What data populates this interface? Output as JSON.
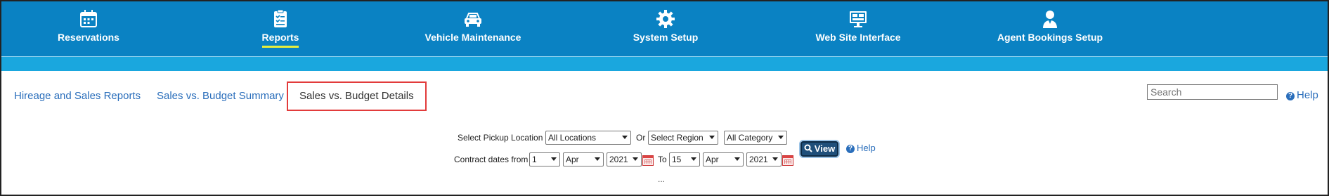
{
  "nav": {
    "items": [
      {
        "label": "Reservations",
        "icon": "calendar-icon"
      },
      {
        "label": "Reports",
        "icon": "clipboard-checklist-icon",
        "active": true
      },
      {
        "label": "Vehicle Maintenance",
        "icon": "car-icon"
      },
      {
        "label": "System Setup",
        "icon": "gear-icon"
      },
      {
        "label": "Web Site Interface",
        "icon": "monitor-icon"
      },
      {
        "label": "Agent Bookings Setup",
        "icon": "agent-user-icon"
      }
    ]
  },
  "tabs": [
    {
      "label": "Hireage and Sales Reports"
    },
    {
      "label": "Sales vs. Budget Summary"
    },
    {
      "label": "Sales vs. Budget Details",
      "selected": true
    }
  ],
  "search": {
    "placeholder": "Search"
  },
  "help_label": "Help",
  "form": {
    "pickup_label": "Select Pickup Location",
    "pickup_value": "All Locations",
    "or_label": "Or",
    "region_value": "Select Region",
    "category_value": "All Category",
    "contract_label": "Contract dates from",
    "from_day": "1",
    "from_month": "Apr",
    "from_year": "2021",
    "to_label": "To",
    "to_day": "15",
    "to_month": "Apr",
    "to_year": "2021",
    "view_label": "View",
    "help_label": "Help",
    "ellipsis": "..."
  },
  "colors": {
    "nav_bg": "#0a82c3",
    "accent_bar": "#1aa7de",
    "active_underline": "#e7ef3c",
    "link": "#2a6ebb",
    "selected_tab_border": "#e23b3b"
  }
}
